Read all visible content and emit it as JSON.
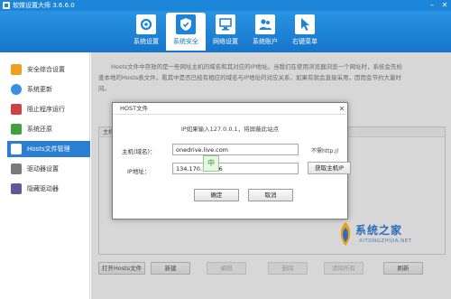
{
  "app": {
    "title": "软媒设置大师 3.6.6.0",
    "accent_color": "#1d85d8"
  },
  "toolbar": {
    "items": [
      {
        "label": "系统设置",
        "icon": "gear-icon"
      },
      {
        "label": "系统安全",
        "icon": "shield-icon",
        "active": true
      },
      {
        "label": "网络设置",
        "icon": "network-icon"
      },
      {
        "label": "系统账户",
        "icon": "users-icon"
      },
      {
        "label": "右键菜单",
        "icon": "cursor-icon"
      }
    ]
  },
  "sidebar": {
    "items": [
      {
        "label": "安全综合设置",
        "icon_color": "#f0a020"
      },
      {
        "label": "系统更新",
        "icon_color": "#3a90e0"
      },
      {
        "label": "阻止程序运行",
        "icon_color": "#d04040"
      },
      {
        "label": "系统还原",
        "icon_color": "#40a040"
      },
      {
        "label": "Hosts文件管理",
        "icon_color": "#2a7fd0",
        "active": true
      },
      {
        "label": "驱动器设置",
        "icon_color": "#7a7a7a"
      },
      {
        "label": "隐藏驱动器",
        "icon_color": "#5a5a9a"
      }
    ]
  },
  "main": {
    "description": [
      "Hosts文件中存放的是一些网址主机的域名和其对应的IP地址。当我们在使用浏览器浏览一个网址时，系统会先检",
      "查本地的Hosts表文件，看其中是否已经有相应的域名与IP地址的对应关系，如果有就会直接采用，因而会节约大量时",
      "间。"
    ],
    "list_header": "主机",
    "buttons": [
      {
        "label": "打开Hosts文件",
        "disabled": false
      },
      {
        "label": "新建",
        "disabled": false
      },
      {
        "label": "编辑",
        "disabled": true
      },
      {
        "label": "删除",
        "disabled": true
      },
      {
        "label": "清除所有",
        "disabled": true
      },
      {
        "label": "刷新",
        "disabled": false
      }
    ]
  },
  "dialog": {
    "title": "HOST文件",
    "hint": "IP如果输入127.0.0.1，将屏蔽此站点",
    "host_label": "主机(域名)：",
    "host_value": "onedrive.live.com",
    "host_note": "不需http://",
    "ip_label": "IP地址：",
    "ip_value": "134.170.108.26",
    "get_ip_label": "获取主机IP",
    "ime_indicator": "中",
    "ok_label": "确定",
    "cancel_label": "取消"
  },
  "watermark": {
    "text": "系统之家",
    "sub": "XITONGZHIJIA.NET"
  }
}
